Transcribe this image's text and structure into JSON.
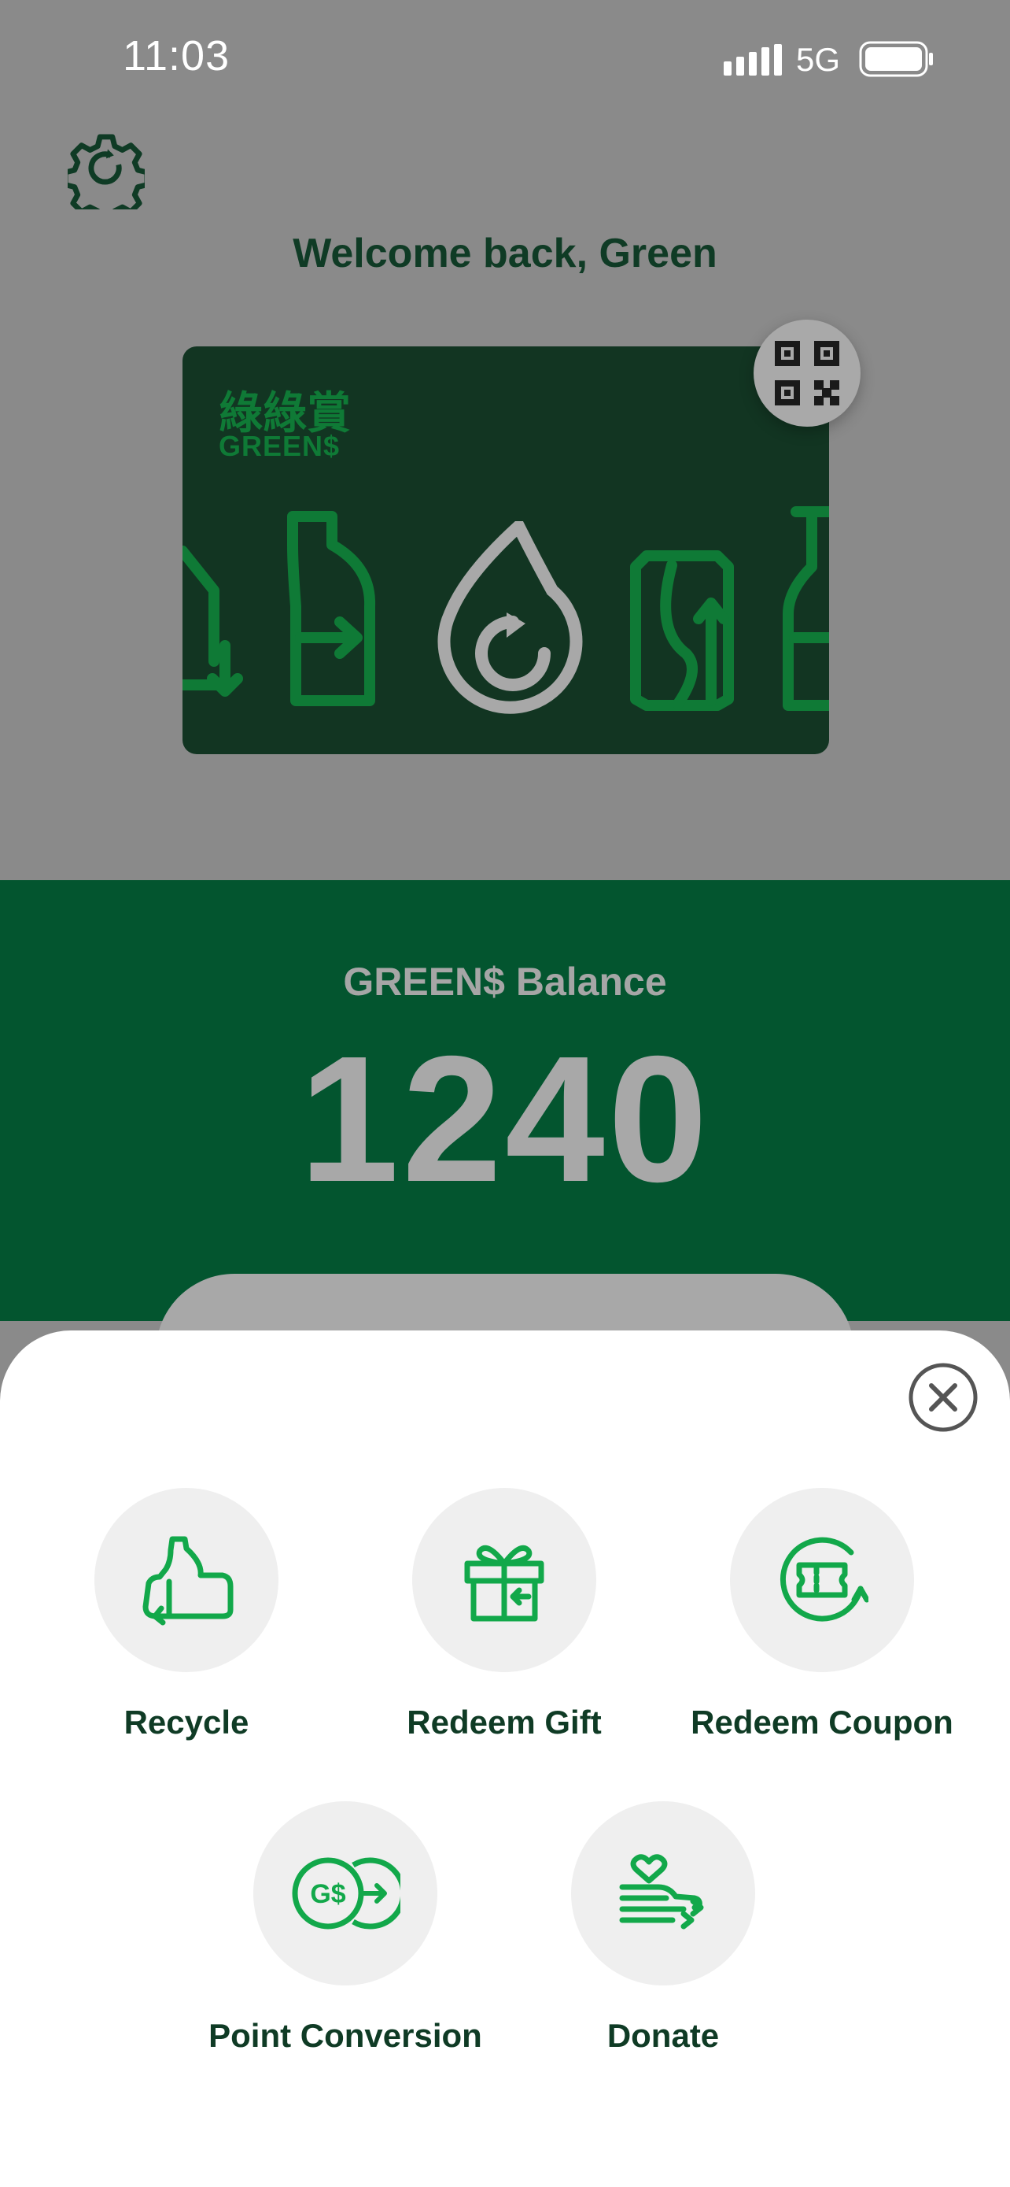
{
  "status_bar": {
    "time": "11:03",
    "network": "5G"
  },
  "header": {
    "welcome_text": "Welcome back,  Green"
  },
  "card": {
    "title_cn": "綠綠賞",
    "title_en": "GREEN$"
  },
  "balance": {
    "label": "GREEN$ Balance",
    "value": "1240"
  },
  "actions": [
    {
      "label": "Recycle",
      "icon": "recycle-bottle-icon"
    },
    {
      "label": "Redeem Gift",
      "icon": "gift-icon"
    },
    {
      "label": "Redeem Coupon",
      "icon": "coupon-icon"
    },
    {
      "label": "Point Conversion",
      "icon": "point-conversion-icon"
    },
    {
      "label": "Donate",
      "icon": "donate-icon"
    }
  ],
  "colors": {
    "accent_green": "#12a84a",
    "dark_green": "#03552f",
    "text_dark_green": "#0f3b25",
    "overlay_gray": "#8a8a8a"
  }
}
